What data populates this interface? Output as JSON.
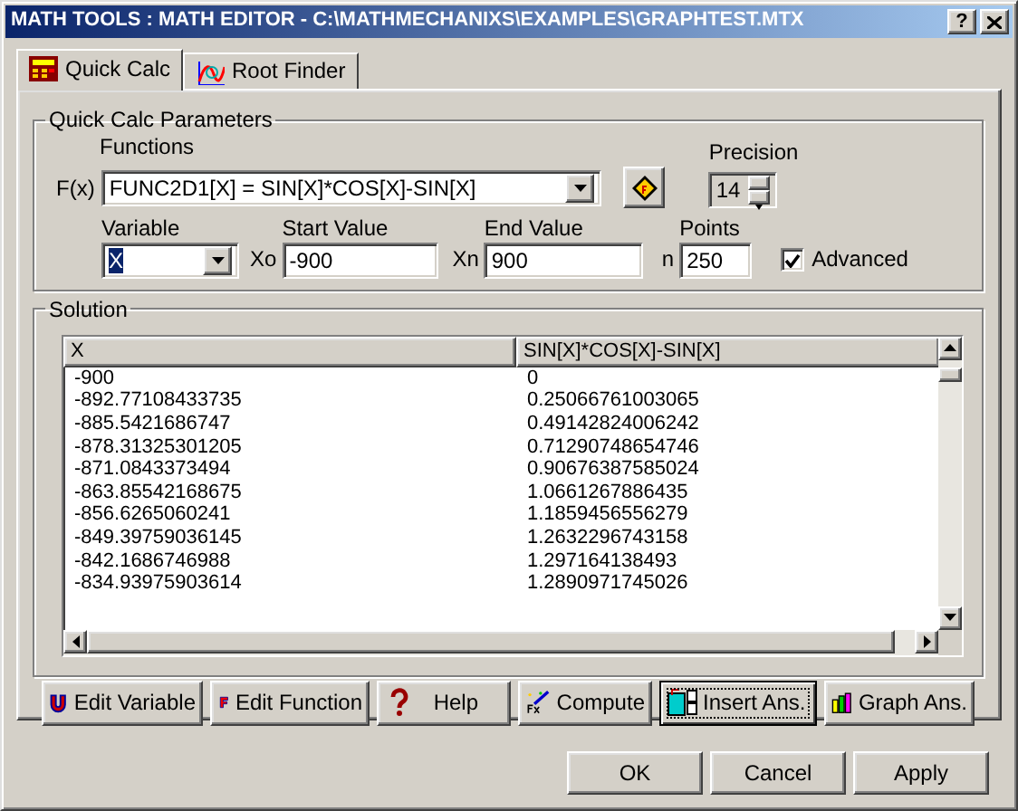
{
  "window": {
    "title": "MATH TOOLS : MATH EDITOR - C:\\MATHMECHANIXS\\EXAMPLES\\GRAPHTEST.MTX",
    "help_button": "?"
  },
  "tabs": [
    {
      "label": "Quick Calc",
      "selected": true,
      "kind": "calc"
    },
    {
      "label": "Root Finder",
      "selected": false,
      "kind": "graph"
    }
  ],
  "parameters": {
    "title": "Quick Calc Parameters",
    "functions_label": "Functions",
    "fx_label": "F(x)",
    "function_value": "FUNC2D1[X] = SIN[X]*COS[X]-SIN[X]",
    "precision_label": "Precision",
    "precision_value": "14",
    "variable_label": "Variable",
    "variable_value": "X",
    "start_prefix": "Xo",
    "start_label": "Start Value",
    "start_value": "-900",
    "end_prefix": "Xn",
    "end_label": "End Value",
    "end_value": "900",
    "points_prefix": "n",
    "points_label": "Points",
    "points_value": "250",
    "advanced": {
      "label": "Advanced",
      "checked": true
    }
  },
  "solution": {
    "title": "Solution",
    "columns": [
      "X",
      "SIN[X]*COS[X]-SIN[X]"
    ],
    "rows": [
      [
        "-900",
        "0"
      ],
      [
        "-892.77108433735",
        "0.25066761003065"
      ],
      [
        "-885.5421686747",
        "0.49142824006242"
      ],
      [
        "-878.31325301205",
        "0.71290748654746"
      ],
      [
        "-871.0843373494",
        "0.90676387585024"
      ],
      [
        "-863.85542168675",
        "1.0661267886435"
      ],
      [
        "-856.6265060241",
        "1.1859456556279"
      ],
      [
        "-849.39759036145",
        "1.2632296743158"
      ],
      [
        "-842.1686746988",
        "1.297164138493"
      ],
      [
        "-834.93975903614",
        "1.2890971745026"
      ]
    ]
  },
  "tool_buttons": [
    {
      "label": "Edit Variable",
      "kind": "variable",
      "focused": false
    },
    {
      "label": "Edit Function",
      "kind": "function",
      "focused": false
    },
    {
      "label": "Help",
      "kind": "help",
      "focused": false
    },
    {
      "label": "Compute",
      "kind": "compute",
      "focused": false
    },
    {
      "label": "Insert Ans.",
      "kind": "insert",
      "focused": true
    },
    {
      "label": "Graph Ans.",
      "kind": "graph",
      "focused": false
    }
  ],
  "dialog_buttons": [
    "OK",
    "Cancel",
    "Apply"
  ]
}
